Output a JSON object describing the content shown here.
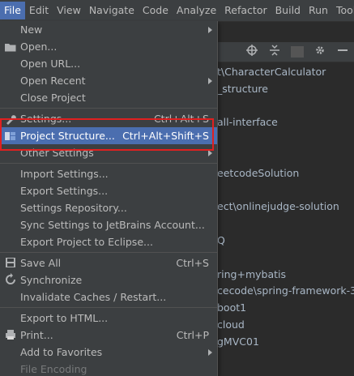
{
  "menubar": {
    "items": [
      "File",
      "Edit",
      "View",
      "Navigate",
      "Code",
      "Analyze",
      "Refactor",
      "Build",
      "Run",
      "Tool"
    ]
  },
  "background": {
    "rows": [
      "t\\CharacterCalculator",
      "_structure",
      "",
      "all-interface",
      "",
      "",
      "eetcodeSolution",
      "",
      "ect\\onlinejudge-solution",
      "",
      "Q",
      "",
      "ring+mybatis",
      "cecode\\spring-framework-3.",
      "boot1",
      "cloud",
      "gMVC01"
    ]
  },
  "file_menu": {
    "new": "New",
    "open": "Open...",
    "open_url": "Open URL...",
    "open_recent": "Open Recent",
    "close_project": "Close Project",
    "settings": "Settings...",
    "settings_shortcut": "Ctrl+Alt+S",
    "project_structure": "Project Structure...",
    "project_structure_shortcut": "Ctrl+Alt+Shift+S",
    "other_settings": "Other Settings",
    "import_settings": "Import Settings...",
    "export_settings": "Export Settings...",
    "settings_repository": "Settings Repository...",
    "sync_settings": "Sync Settings to JetBrains Account...",
    "export_eclipse": "Export Project to Eclipse...",
    "save_all": "Save All",
    "save_all_shortcut": "Ctrl+S",
    "synchronize": "Synchronize",
    "invalidate_caches": "Invalidate Caches / Restart...",
    "export_html": "Export to HTML...",
    "print": "Print...",
    "print_shortcut": "Ctrl+P",
    "add_favorites": "Add to Favorites",
    "file_encoding": "File Encoding"
  },
  "colors": {
    "highlight": "#4b6eaf",
    "annotation_box": "#e02020"
  }
}
